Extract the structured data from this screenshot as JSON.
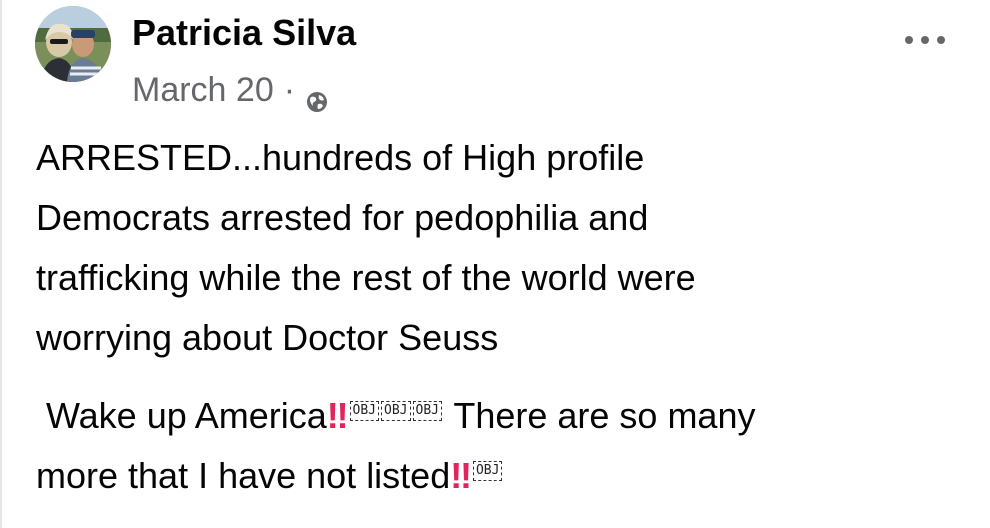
{
  "post": {
    "author": "Patricia Silva",
    "date": "March 20",
    "separator": "·",
    "privacy_icon": "globe-icon",
    "more_icon": "more-options-icon",
    "paragraph1_lines": [
      "ARRESTED...hundreds of High profile",
      "Democrats arrested for pedophilia and",
      "trafficking while the rest of the world were",
      "worrying  about Doctor Seuss"
    ],
    "paragraph2": {
      "line1_start": " Wake up America",
      "line1_end": " There are so many",
      "line2_start": "more that I have not listed",
      "emoji_bang": "‼",
      "obj_placeholder": "OBJ"
    },
    "colors": {
      "text": "#050505",
      "secondary": "#65676b",
      "emoji_red": "#e0245e"
    }
  }
}
